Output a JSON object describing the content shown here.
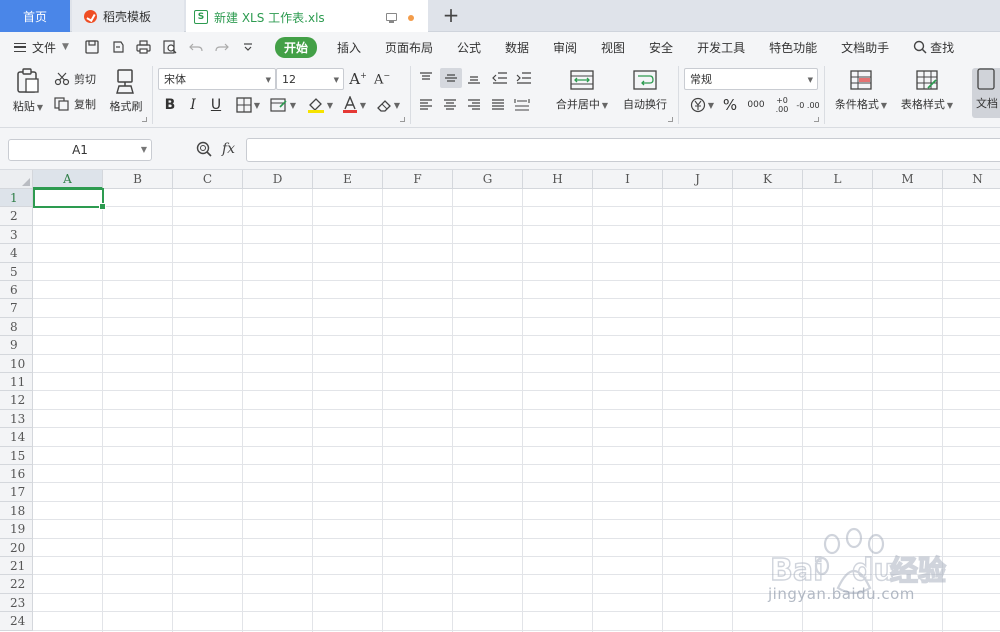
{
  "tabs": {
    "home": "首页",
    "template": "稻壳模板",
    "file": "新建 XLS 工作表.xls",
    "file_icon": "S"
  },
  "menubar": {
    "file_menu": "文件",
    "tabs": [
      "开始",
      "插入",
      "页面布局",
      "公式",
      "数据",
      "审阅",
      "视图",
      "安全",
      "开发工具",
      "特色功能",
      "文档助手"
    ],
    "active_tab": "开始",
    "search": "查找"
  },
  "ribbon": {
    "paste": "粘贴",
    "cut": "剪切",
    "copy": "复制",
    "format_painter": "格式刷",
    "font_name": "宋体",
    "font_size": "12",
    "bold": "B",
    "italic": "I",
    "underline": "U",
    "merge_center": "合并居中",
    "wrap_text": "自动换行",
    "number_format": "常规",
    "percent": "%",
    "thousands": "000",
    "dec_increase": "+0 .00",
    "dec_decrease": "-0 .00",
    "conditional_format": "条件格式",
    "table_style": "表格样式",
    "doc": "文档"
  },
  "formula_bar": {
    "name_box": "A1",
    "fx": "fx",
    "formula": ""
  },
  "sheet": {
    "columns": [
      "A",
      "B",
      "C",
      "D",
      "E",
      "F",
      "G",
      "H",
      "I",
      "J",
      "K",
      "L",
      "M",
      "N"
    ],
    "rows": [
      "1",
      "2",
      "3",
      "4",
      "5",
      "6",
      "7",
      "8",
      "9",
      "10",
      "11",
      "12",
      "13",
      "14",
      "15",
      "16",
      "17",
      "18",
      "19",
      "20",
      "21",
      "22",
      "23",
      "24"
    ],
    "active_column": "A",
    "active_row": "1"
  },
  "watermark": {
    "brand": "Bai du 经验",
    "url": "jingyan.baidu.com"
  },
  "colors": {
    "accent_green": "#2d9b50",
    "home_tab_blue": "#4a86e8",
    "active_tab_green": "#43a047"
  }
}
